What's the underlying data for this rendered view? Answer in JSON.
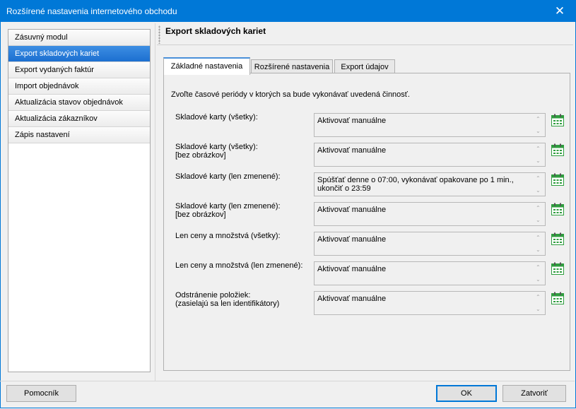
{
  "window": {
    "title": "Rozšírené nastavenia internetového obchodu",
    "close_label": "✕"
  },
  "sidebar": {
    "items": [
      {
        "label": "Zásuvný modul",
        "active": false
      },
      {
        "label": "Export skladových kariet",
        "active": true
      },
      {
        "label": "Export vydaných faktúr",
        "active": false
      },
      {
        "label": "Import objednávok",
        "active": false
      },
      {
        "label": "Aktualizácia stavov objednávok",
        "active": false
      },
      {
        "label": "Aktualizácia zákazníkov",
        "active": false
      },
      {
        "label": "Zápis nastavení",
        "active": false
      }
    ]
  },
  "section": {
    "title": "Export skladových kariet"
  },
  "tabs": [
    {
      "label": "Základné nastavenia",
      "active": true
    },
    {
      "label": "Rozšírené nastavenia",
      "active": false
    },
    {
      "label": "Export údajov",
      "active": false
    }
  ],
  "intro": "Zvoľte časové periódy v ktorých sa bude vykonávať uvedená činnosť.",
  "rows": [
    {
      "label": "Skladové karty (všetky):",
      "sublabel": "",
      "value": "Aktivovať manuálne"
    },
    {
      "label": "Skladové karty (všetky):",
      "sublabel": "[bez obrázkov]",
      "value": "Aktivovať manuálne"
    },
    {
      "label": "Skladové karty (len zmenené):",
      "sublabel": "",
      "value": "Spúšťať denne o 07:00, vykonávať opakovane po 1 min., ukončiť o 23:59"
    },
    {
      "label": "Skladové karty (len zmenené):",
      "sublabel": "[bez obrázkov]",
      "value": "Aktivovať manuálne"
    },
    {
      "label": "Len ceny a množstvá (všetky):",
      "sublabel": "",
      "value": "Aktivovať manuálne"
    },
    {
      "label": "Len ceny a množstvá (len zmenené):",
      "sublabel": "",
      "value": "Aktivovať manuálne"
    },
    {
      "label": "Odstránenie položiek:",
      "sublabel": "(zasielajú sa len identifikátory)",
      "value": "Aktivovať manuálne"
    }
  ],
  "icons": {
    "schedule": "calendar-schedule-icon",
    "scroll_up": "scroll-up-arrow-icon",
    "scroll_down": "scroll-down-arrow-icon"
  },
  "footer": {
    "help_label": "Pomocník",
    "ok_label": "OK",
    "close_label": "Zatvoriť"
  },
  "colors": {
    "title_bar": "#0078d7",
    "selected_item": "#1c6fd0",
    "icon_green": "#2e9d3e"
  }
}
